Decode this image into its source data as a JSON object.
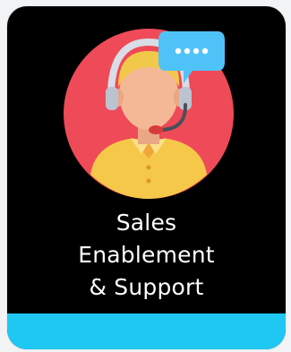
{
  "card": {
    "title_lines": [
      "Sales",
      "Enablement",
      "& Support"
    ],
    "icon": "customer-support-agent-icon",
    "chat_icon": "chat-bubble-icon",
    "accent_color": "#1fc8f3"
  }
}
